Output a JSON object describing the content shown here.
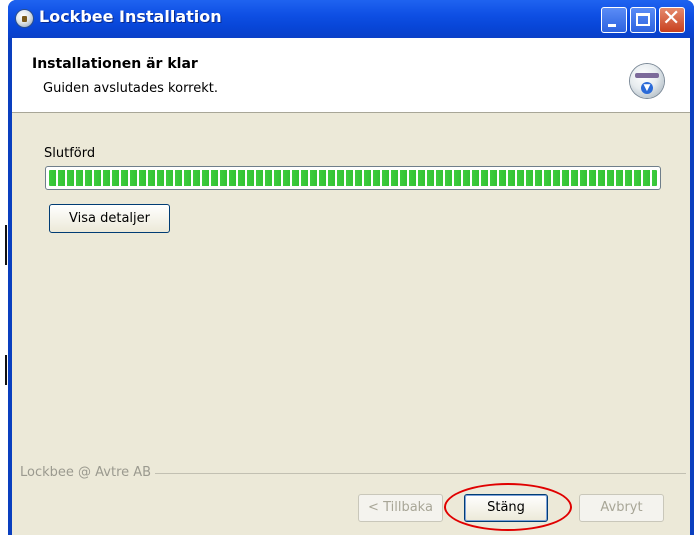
{
  "window": {
    "title": "Lockbee Installation",
    "icon": "installer-globe-icon",
    "controls": [
      "minimize-icon",
      "maximize-icon",
      "close-icon"
    ]
  },
  "header": {
    "title": "Installationen är klar",
    "subtitle": "Guiden avslutades korrekt.",
    "icon": "installer-disc-icon"
  },
  "main": {
    "status_label": "Slutförd",
    "progress_fraction": 1.0,
    "details_button": "Visa detaljer"
  },
  "footer": {
    "brand": "Lockbee @ Avtre AB"
  },
  "buttons": {
    "back": "< Tillbaka",
    "close": "Stäng",
    "cancel": "Avbryt"
  },
  "colors": {
    "titlebar": "#0846d8",
    "dialog_bg": "#ece9d8",
    "progress_green": "#3dcc3d",
    "highlight": "#e00000"
  }
}
